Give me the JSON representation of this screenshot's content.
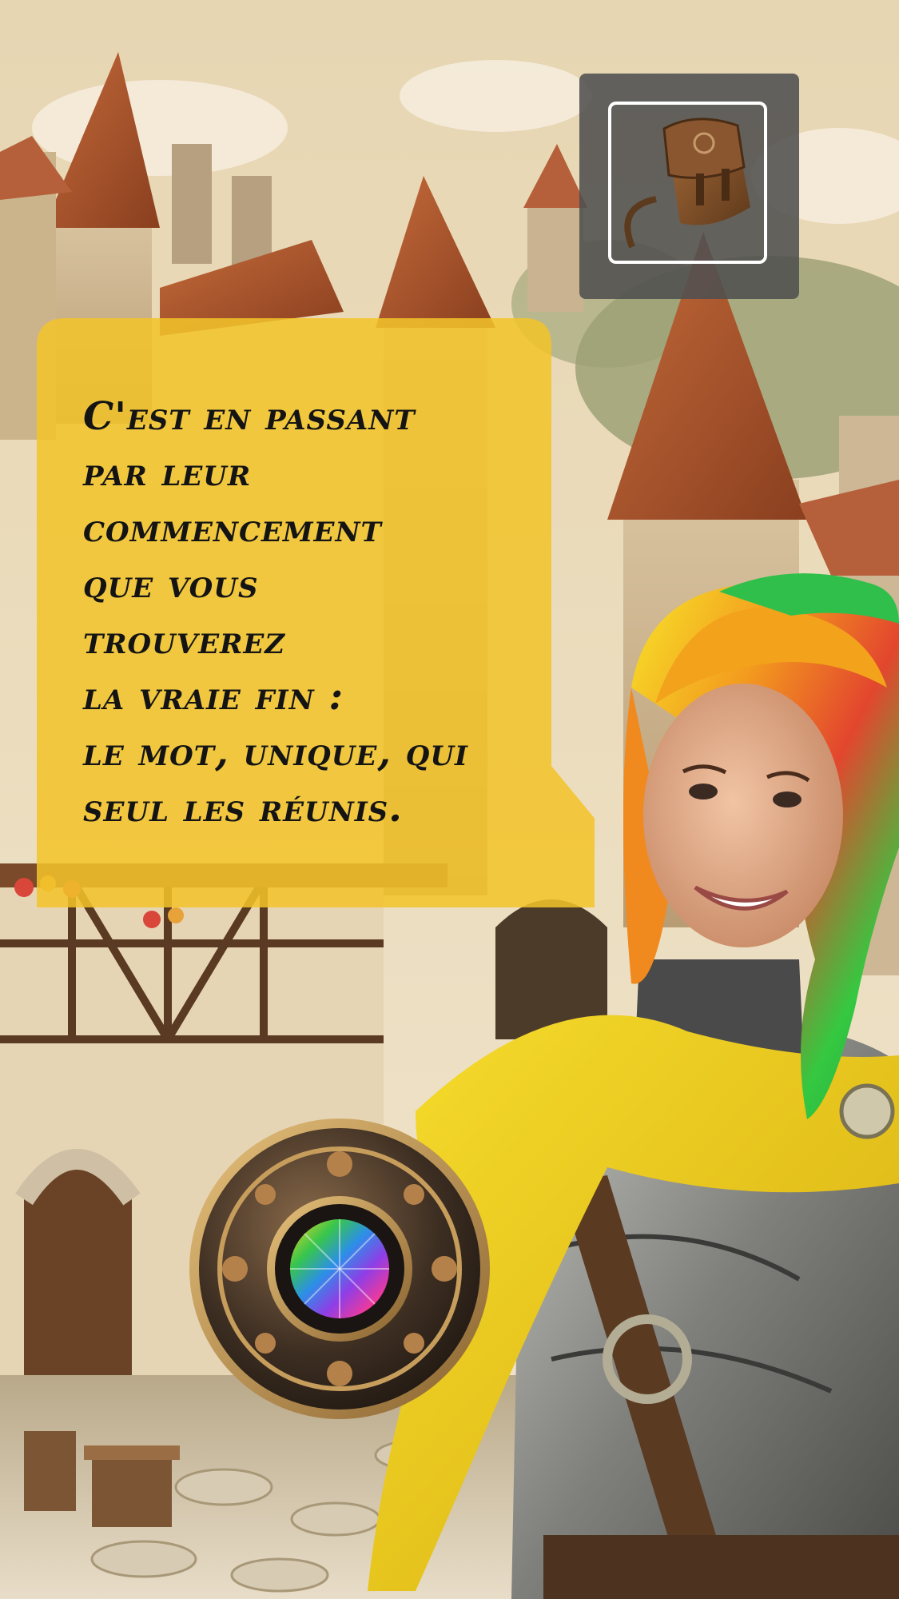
{
  "scene": {
    "background": "medieval-village",
    "colors": {
      "sky": "#e9d8b6",
      "bubble": "#f2c42a",
      "bag_panel": "#505050",
      "scarf": "#f2cf1a"
    }
  },
  "inventory": {
    "icon": "leather-satchel-icon"
  },
  "dialog": {
    "text": "C'est en passant\npar leur\ncommencement\nque vous\ntrouverez\nla vraie fin :\nle mot, unique, qui\nseul les réunis."
  },
  "medallion": {
    "icon": "rainbow-gem-medallion-icon"
  },
  "character": {
    "icon": "rainbow-haired-warrior-portrait"
  }
}
